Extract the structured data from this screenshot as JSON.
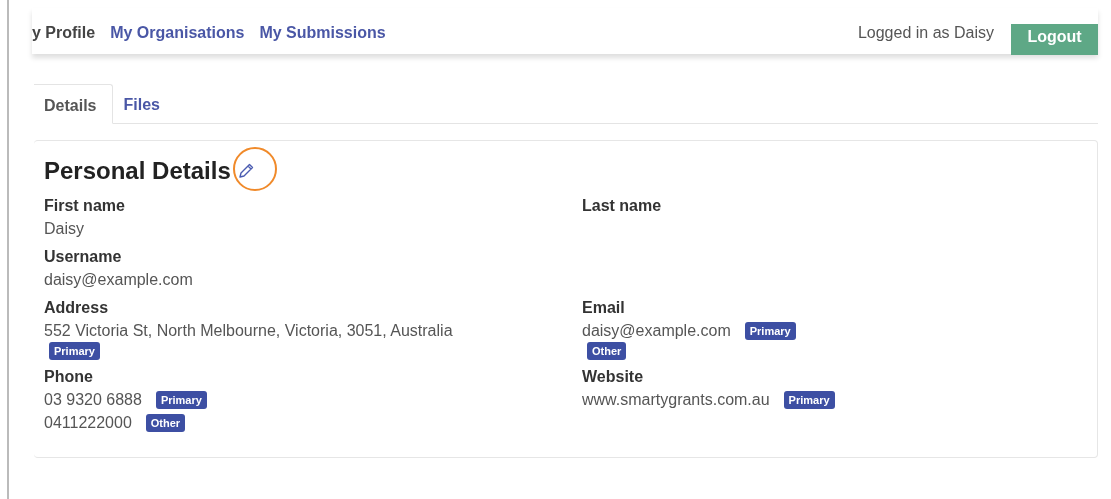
{
  "nav": {
    "links": [
      {
        "label": "y Profile",
        "selected": true
      },
      {
        "label": "My Organisations",
        "selected": false
      },
      {
        "label": "My Submissions",
        "selected": false
      }
    ],
    "user": "Logged in as Daisy",
    "logout": "Logout"
  },
  "tabs": [
    {
      "label": "Details",
      "selected": true
    },
    {
      "label": "Files",
      "selected": false
    }
  ],
  "card": {
    "title": "Personal Details",
    "rows": [
      [
        {
          "label": "First name",
          "values": [
            {
              "text": "Daisy"
            }
          ]
        },
        {
          "label": "Last name"
        }
      ],
      [
        {
          "label": "Username",
          "values": [
            {
              "text": "daisy@example.com"
            }
          ]
        }
      ],
      [
        {
          "label": "Address",
          "values": [
            {
              "text": "552 Victoria St, North Melbourne, Victoria, 3051, Australia"
            },
            {
              "tag": "Primary"
            }
          ]
        },
        {
          "label": "Email",
          "values": [
            {
              "text": "daisy@example.com",
              "tag": "Primary"
            },
            {
              "tag": "Other"
            }
          ]
        }
      ],
      [
        {
          "label": "Phone",
          "values": [
            {
              "text": "03 9320 6888",
              "tag": "Primary"
            },
            {
              "text": "0411222000",
              "tag": "Other"
            }
          ]
        },
        {
          "label": "Website",
          "values": [
            {
              "text": "www.smartygrants.com.au",
              "tag": "Primary"
            }
          ]
        }
      ]
    ]
  }
}
